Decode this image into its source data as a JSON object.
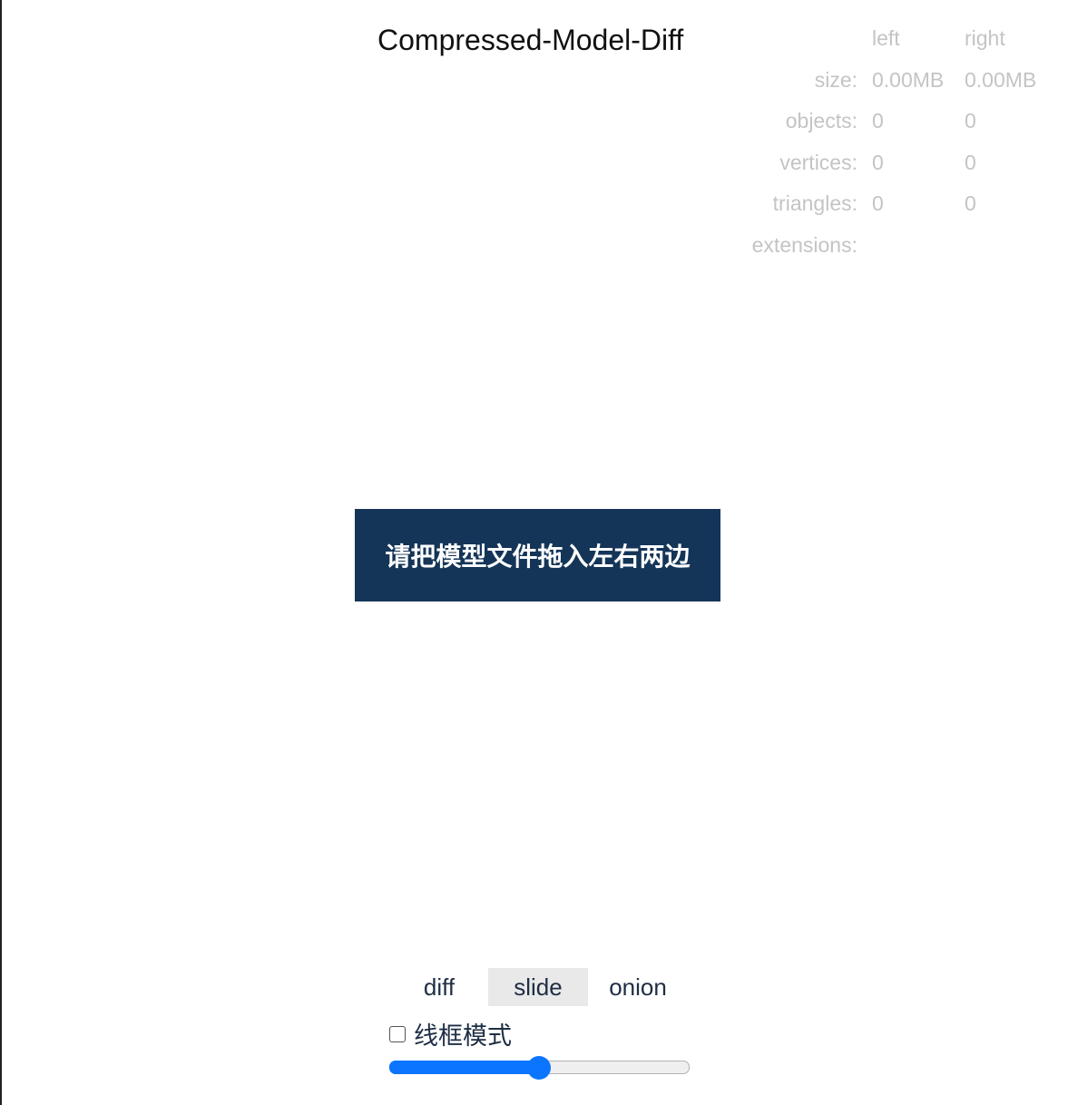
{
  "app": {
    "title": "Compressed-Model-Diff"
  },
  "stats": {
    "columns": {
      "left": "left",
      "right": "right"
    },
    "rows": [
      {
        "label": "size:",
        "left": "0.00MB",
        "right": "0.00MB"
      },
      {
        "label": "objects:",
        "left": "0",
        "right": "0"
      },
      {
        "label": "vertices:",
        "left": "0",
        "right": "0"
      },
      {
        "label": "triangles:",
        "left": "0",
        "right": "0"
      },
      {
        "label": "extensions:",
        "left": "",
        "right": ""
      }
    ]
  },
  "drop_hint": "请把模型文件拖入左右两边",
  "modes": {
    "items": [
      "diff",
      "slide",
      "onion"
    ],
    "selected": "slide"
  },
  "wireframe": {
    "label": "线框模式",
    "checked": false
  },
  "slider": {
    "value": 0.5
  },
  "colors": {
    "accent": "#0b75ff",
    "hint_bg": "#143557",
    "muted_text": "#c4c4c4"
  }
}
